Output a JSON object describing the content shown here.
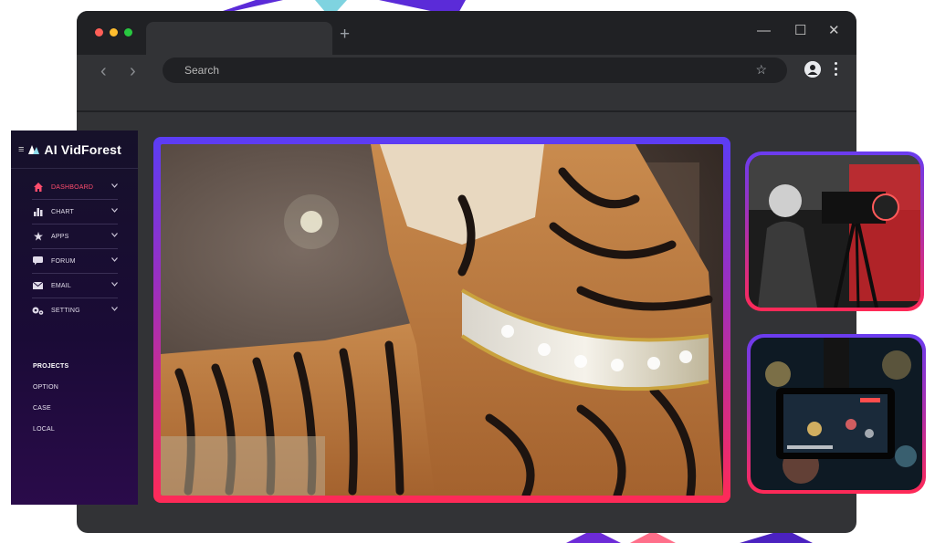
{
  "browser": {
    "search_placeholder": "Search",
    "new_tab_symbol": "+",
    "window_controls": {
      "minimize": "—",
      "maximize": "☐",
      "close": "✕"
    },
    "nav": {
      "back": "‹",
      "forward": "›"
    },
    "traffic_light_colors": [
      "#ff5f57",
      "#ffbd2e",
      "#28c840"
    ]
  },
  "sidebar": {
    "brand": "AI VidForest",
    "menu_items": [
      {
        "label": "DASHBOARD",
        "icon": "home-icon",
        "active": true
      },
      {
        "label": "CHART",
        "icon": "bar-chart-icon",
        "active": false
      },
      {
        "label": "APPS",
        "icon": "star-icon",
        "active": false
      },
      {
        "label": "FORUM",
        "icon": "chat-icon",
        "active": false
      },
      {
        "label": "EMAIL",
        "icon": "mail-icon",
        "active": false
      },
      {
        "label": "SETTING",
        "icon": "gears-icon",
        "active": false
      }
    ],
    "projects_heading": "PROJECTS",
    "projects": [
      "OPTION",
      "CASE",
      "LOCAL"
    ]
  },
  "colors": {
    "accent_active": "#ff4d6d",
    "frame_gradient_top": "#5b3df5",
    "frame_gradient_bottom": "#ff2a57"
  },
  "main_image": {
    "icon": "tiger-with-jeweled-collar-image"
  },
  "thumbnails": [
    {
      "icon": "cameraman-filming-image"
    },
    {
      "icon": "camera-viewfinder-image"
    }
  ]
}
